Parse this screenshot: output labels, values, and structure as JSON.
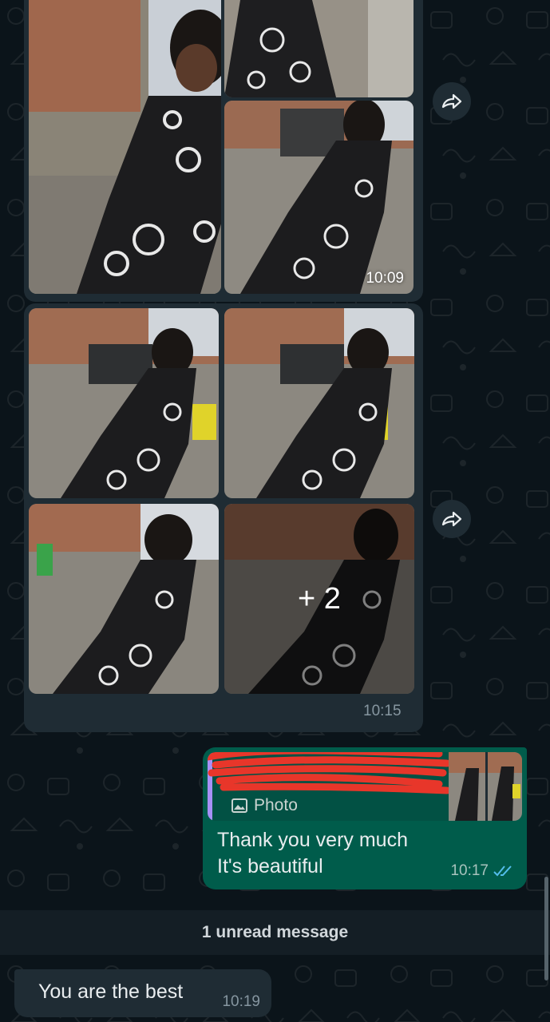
{
  "colors": {
    "background": "#0b141a",
    "incoming_bubble": "#1f2c34",
    "outgoing_bubble": "#005c4b",
    "read_ticks": "#53bdeb",
    "quote_accent": "#a791f7"
  },
  "album_1": {
    "time": "10:09"
  },
  "album_2": {
    "more_count": "+ 2",
    "time": "10:15"
  },
  "reply_message": {
    "quoted_label": "Photo",
    "text_line1": "Thank you very much",
    "text_line2": "It's beautiful",
    "time": "10:17",
    "status_icon": "double-check-icon"
  },
  "unread_banner": "1 unread message",
  "last_message": {
    "text": "You are the best",
    "time": "10:19"
  }
}
